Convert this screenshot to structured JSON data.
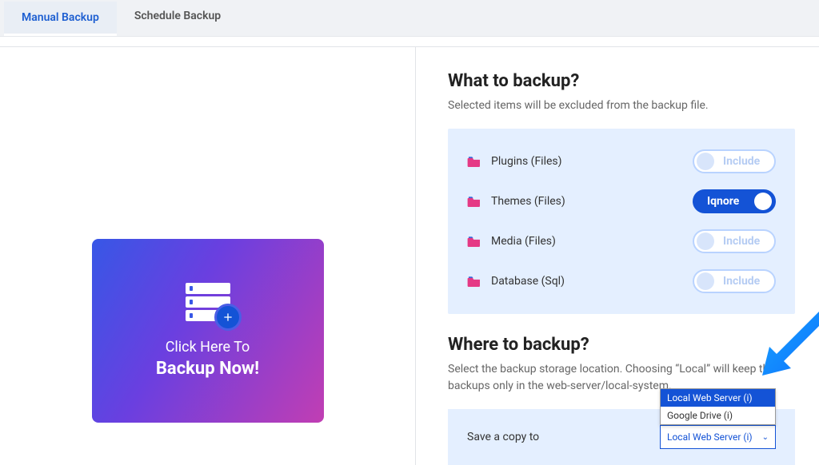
{
  "tabs": {
    "manual": {
      "label": "Manual Backup"
    },
    "schedule": {
      "label": "Schedule Backup"
    }
  },
  "card": {
    "line1": "Click Here To",
    "line2": "Backup Now!"
  },
  "what": {
    "title": "What to backup?",
    "sub": "Selected items will be excluded from the backup file.",
    "items": [
      {
        "label": "Plugins (Files)",
        "toggle_text": "Include",
        "on": false
      },
      {
        "label": "Themes (Files)",
        "toggle_text": "Iqnore",
        "on": true
      },
      {
        "label": "Media (Files)",
        "toggle_text": "Include",
        "on": false
      },
      {
        "label": "Database (Sql)",
        "toggle_text": "Include",
        "on": false
      }
    ]
  },
  "where": {
    "title": "Where to backup?",
    "sub": "Select the backup storage location. Choosing “Local” will keep the backups only in the web-server/local-system.",
    "save_label": "Save a copy to",
    "selected": "Local Web Server (i)",
    "options": [
      {
        "label": "Local Web Server (i)",
        "selected": true
      },
      {
        "label": "Google Drive (i)",
        "selected": false
      }
    ]
  }
}
